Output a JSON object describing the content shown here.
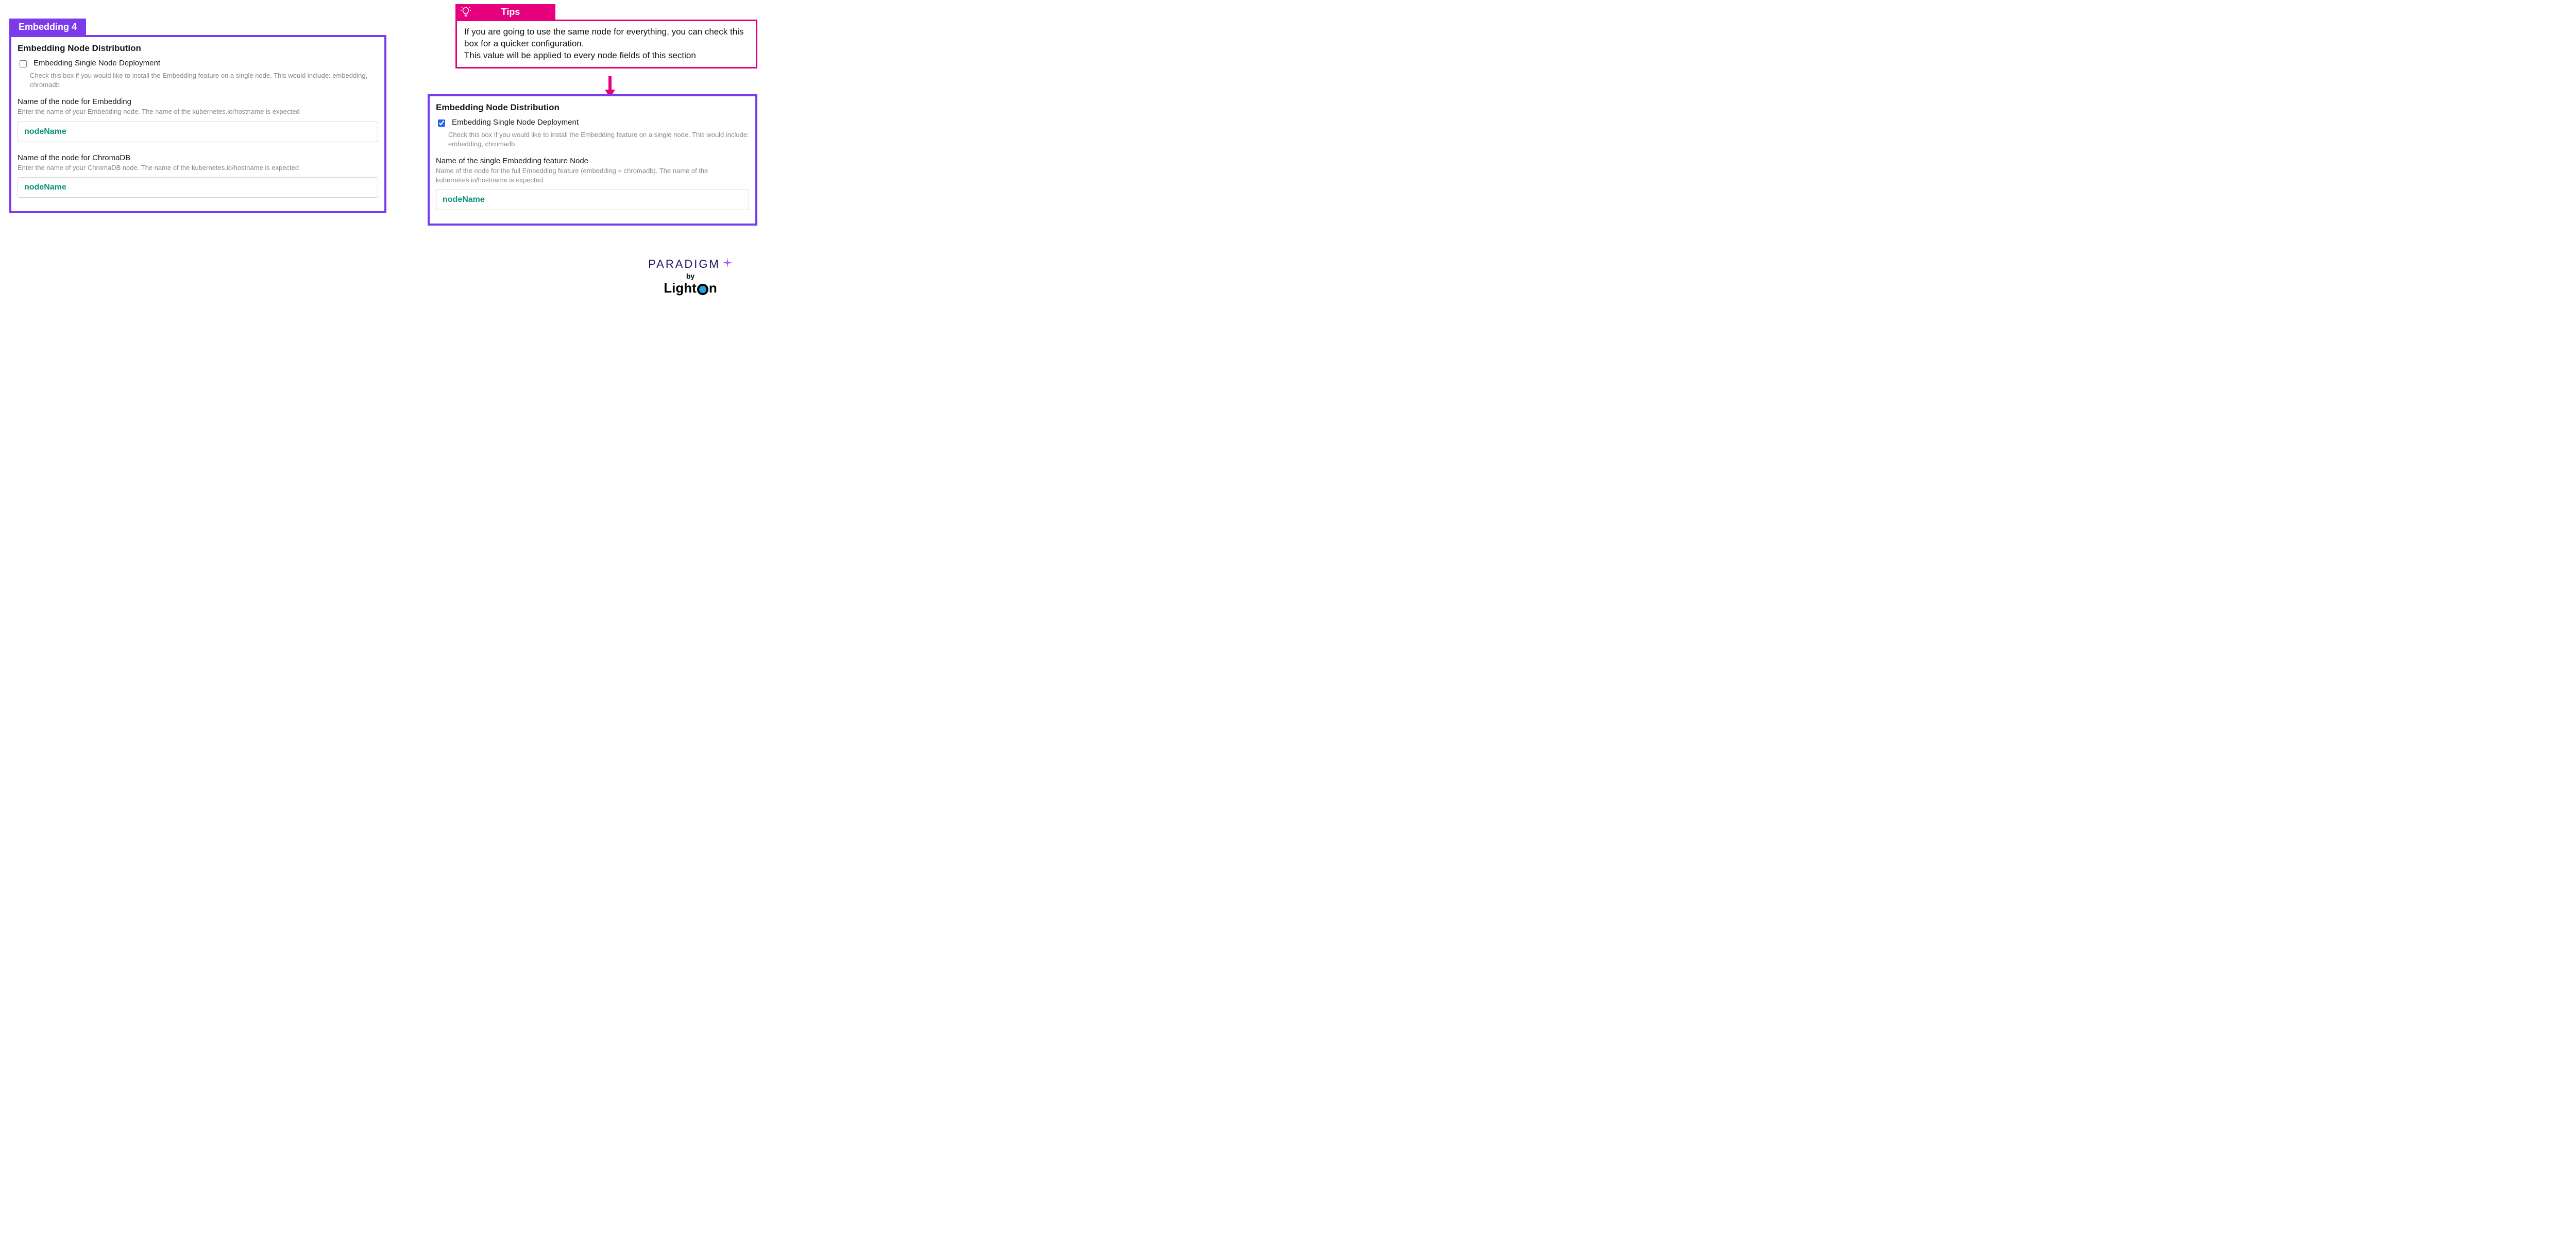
{
  "colors": {
    "purple": "#7c3aed",
    "pink": "#e6007e",
    "teal": "#0f8f7a"
  },
  "left_panel": {
    "tab_label": "Embedding 4",
    "section_title": "Embedding Node Distribution",
    "checkbox": {
      "label": "Embedding Single Node Deployment",
      "checked": false,
      "description": "Check this box if you would like to install the Embedding feature on a single node. This would include: embedding, chromadb"
    },
    "fields": [
      {
        "label": "Name of the node for Embedding",
        "description": "Enter the name of your Embedding node. The name of the kubernetes.io/hostname is expected",
        "value": "nodeName"
      },
      {
        "label": "Name of the node for ChromaDB",
        "description": "Enter the name of your ChromaDB node. The name of the kubernetes.io/hostname is expected",
        "value": "nodeName"
      }
    ]
  },
  "tips": {
    "tab_label": "Tips",
    "body_line1": "If you are going to use the same node for everything, you can check this box for a quicker configuration.",
    "body_line2": "This value will be applied to every node fields of this section"
  },
  "right_panel": {
    "section_title": "Embedding Node Distribution",
    "checkbox": {
      "label": "Embedding Single Node Deployment",
      "checked": true,
      "description": "Check this box if you would like to install the Embedding feature on a single node. This would include: embedding, chromadb"
    },
    "fields": [
      {
        "label": "Name of the single Embedding feature Node",
        "description": "Name of the node for the full Embedding feature (embedding + chromadb). The name of the kubernetes.io/hostname is expected",
        "value": "nodeName"
      }
    ]
  },
  "brand": {
    "paradigm": "PARADIGM",
    "by": "by",
    "lighton_left": "Light",
    "lighton_right": "n"
  }
}
